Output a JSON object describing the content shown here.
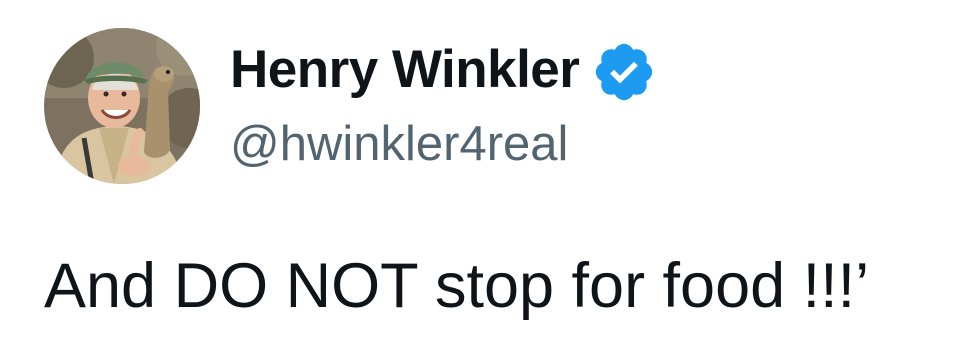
{
  "author": {
    "display_name": "Henry Winkler",
    "handle": "@hwinkler4real",
    "verified": true,
    "avatar_icon": "profile-photo-man-with-meerkat"
  },
  "tweet": {
    "text": "And DO NOT stop for food !!!’"
  },
  "colors": {
    "name": "#0f1419",
    "handle": "#536471",
    "verified": "#1d9bf0",
    "background": "#ffffff"
  }
}
